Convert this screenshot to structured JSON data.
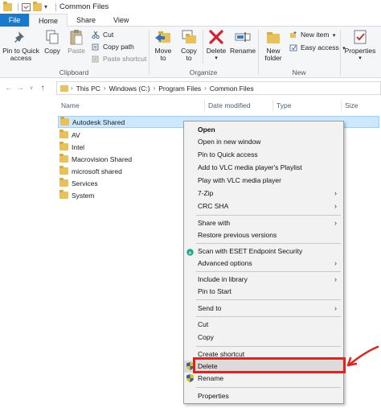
{
  "window": {
    "title": "Common Files"
  },
  "tabs": [
    {
      "label": "File"
    },
    {
      "label": "Home"
    },
    {
      "label": "Share"
    },
    {
      "label": "View"
    }
  ],
  "ribbon": {
    "clipboard": {
      "label": "Clipboard",
      "pin": "Pin to Quick access",
      "pin_line1": "Pin to Quick",
      "pin_line2": "access",
      "copy": "Copy",
      "paste": "Paste",
      "cut": "Cut",
      "copy_path": "Copy path",
      "paste_shortcut": "Paste shortcut"
    },
    "organize": {
      "label": "Organize",
      "move_to_line1": "Move",
      "move_to_line2": "to",
      "copy_to_line1": "Copy",
      "copy_to_line2": "to",
      "delete": "Delete",
      "rename": "Rename"
    },
    "new": {
      "label": "New",
      "new_folder_line1": "New",
      "new_folder_line2": "folder",
      "new_item": "New item",
      "easy_access": "Easy access"
    },
    "open": {
      "properties": "Properties"
    }
  },
  "address": {
    "crumbs": [
      "This PC",
      "Windows (C:)",
      "Program Files",
      "Common Files"
    ]
  },
  "columns": {
    "name": "Name",
    "date": "Date modified",
    "type": "Type",
    "size": "Size"
  },
  "files": [
    {
      "name": "Autodesk Shared"
    },
    {
      "name": "AV"
    },
    {
      "name": "Intel"
    },
    {
      "name": "Macrovision Shared"
    },
    {
      "name": "microsoft shared"
    },
    {
      "name": "Services"
    },
    {
      "name": "System"
    }
  ],
  "context_menu": {
    "open": "Open",
    "open_new_window": "Open in new window",
    "pin_quick_access": "Pin to Quick access",
    "vlc_playlist": "Add to VLC media player's Playlist",
    "vlc_play": "Play with VLC media player",
    "zip": "7-Zip",
    "crc": "CRC SHA",
    "share_with": "Share with",
    "restore": "Restore previous versions",
    "eset": "Scan with ESET Endpoint Security",
    "advanced": "Advanced options",
    "library": "Include in library",
    "pin_start": "Pin to Start",
    "send_to": "Send to",
    "cut": "Cut",
    "copy": "Copy",
    "create_shortcut": "Create shortcut",
    "delete": "Delete",
    "rename": "Rename",
    "properties": "Properties"
  },
  "colors": {
    "accent": "#1979ca",
    "highlight_box": "#e0231f",
    "selection": "#cce8ff",
    "folder": "#e8c15a"
  }
}
